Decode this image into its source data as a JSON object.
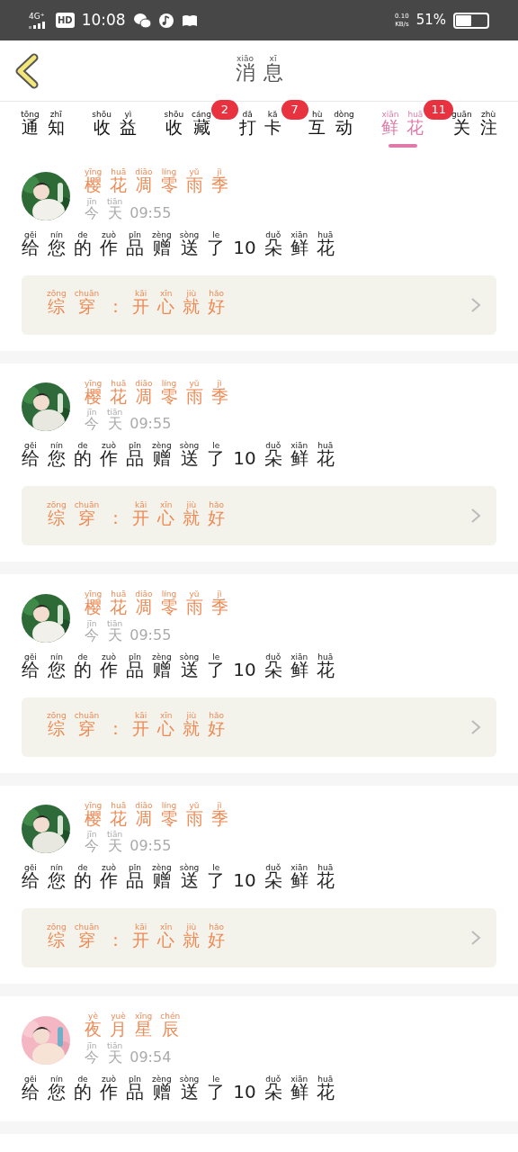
{
  "status_bar": {
    "network": "4G⁺",
    "hd": "HD",
    "time": "10:08",
    "speed": "0.10",
    "speed_unit": "KB/s",
    "battery": "51%"
  },
  "header": {
    "title": [
      [
        "xiāo",
        "消"
      ],
      [
        "xī",
        "息"
      ]
    ]
  },
  "tabs": [
    {
      "label": [
        [
          "tōng",
          "通"
        ],
        [
          "zhī",
          "知"
        ]
      ],
      "selected": false
    },
    {
      "label": [
        [
          "shōu",
          "收"
        ],
        [
          "yì",
          "益"
        ]
      ],
      "selected": false
    },
    {
      "label": [
        [
          "shōu",
          "收"
        ],
        [
          "cáng",
          "藏"
        ]
      ],
      "selected": false,
      "badge": "2"
    },
    {
      "label": [
        [
          "dǎ",
          "打"
        ],
        [
          "kǎ",
          "卡"
        ]
      ],
      "selected": false,
      "badge": "7"
    },
    {
      "label": [
        [
          "hù",
          "互"
        ],
        [
          "dòng",
          "动"
        ]
      ],
      "selected": false
    },
    {
      "label": [
        [
          "xiān",
          "鲜"
        ],
        [
          "huā",
          "花"
        ]
      ],
      "selected": true,
      "badge": "11"
    },
    {
      "label": [
        [
          "guān",
          "关"
        ],
        [
          "zhù",
          "注"
        ]
      ],
      "selected": false
    }
  ],
  "messages": [
    {
      "avatar": {
        "kind": "picture"
      },
      "name": [
        [
          "yīng",
          "樱"
        ],
        [
          "huā",
          "花"
        ],
        [
          "diāo",
          "凋"
        ],
        [
          "líng",
          "零"
        ],
        [
          "yǔ",
          "雨"
        ],
        [
          "jì",
          "季"
        ]
      ],
      "day": [
        [
          "jīn",
          "今"
        ],
        [
          "tiān",
          "天"
        ]
      ],
      "time": "09:55",
      "text": [
        [
          "gěi",
          "给"
        ],
        [
          "nín",
          "您"
        ],
        [
          "de",
          "的"
        ],
        [
          "zuò",
          "作"
        ],
        [
          "pǐn",
          "品"
        ],
        [
          "zèng",
          "赠"
        ],
        [
          "sòng",
          "送"
        ],
        [
          "le",
          "了"
        ],
        [
          "10"
        ],
        [
          "duǒ",
          "朵"
        ],
        [
          "xiān",
          "鲜"
        ],
        [
          "huā",
          "花"
        ]
      ],
      "work": [
        [
          "zōng",
          "综"
        ],
        [
          "chuān",
          "穿"
        ],
        [
          "："
        ],
        [
          "kāi",
          "开"
        ],
        [
          "xīn",
          "心"
        ],
        [
          "jiù",
          "就"
        ],
        [
          "hǎo",
          "好"
        ]
      ]
    },
    {
      "avatar": {
        "kind": "picture"
      },
      "name": [
        [
          "yīng",
          "樱"
        ],
        [
          "huā",
          "花"
        ],
        [
          "diāo",
          "凋"
        ],
        [
          "líng",
          "零"
        ],
        [
          "yǔ",
          "雨"
        ],
        [
          "jì",
          "季"
        ]
      ],
      "day": [
        [
          "jīn",
          "今"
        ],
        [
          "tiān",
          "天"
        ]
      ],
      "time": "09:55",
      "text": [
        [
          "gěi",
          "给"
        ],
        [
          "nín",
          "您"
        ],
        [
          "de",
          "的"
        ],
        [
          "zuò",
          "作"
        ],
        [
          "pǐn",
          "品"
        ],
        [
          "zèng",
          "赠"
        ],
        [
          "sòng",
          "送"
        ],
        [
          "le",
          "了"
        ],
        [
          "10"
        ],
        [
          "duǒ",
          "朵"
        ],
        [
          "xiān",
          "鲜"
        ],
        [
          "huā",
          "花"
        ]
      ],
      "work": [
        [
          "zōng",
          "综"
        ],
        [
          "chuān",
          "穿"
        ],
        [
          "："
        ],
        [
          "kāi",
          "开"
        ],
        [
          "xīn",
          "心"
        ],
        [
          "jiù",
          "就"
        ],
        [
          "hǎo",
          "好"
        ]
      ]
    },
    {
      "avatar": {
        "kind": "picture"
      },
      "name": [
        [
          "yīng",
          "樱"
        ],
        [
          "huā",
          "花"
        ],
        [
          "diāo",
          "凋"
        ],
        [
          "líng",
          "零"
        ],
        [
          "yǔ",
          "雨"
        ],
        [
          "jì",
          "季"
        ]
      ],
      "day": [
        [
          "jīn",
          "今"
        ],
        [
          "tiān",
          "天"
        ]
      ],
      "time": "09:55",
      "text": [
        [
          "gěi",
          "给"
        ],
        [
          "nín",
          "您"
        ],
        [
          "de",
          "的"
        ],
        [
          "zuò",
          "作"
        ],
        [
          "pǐn",
          "品"
        ],
        [
          "zèng",
          "赠"
        ],
        [
          "sòng",
          "送"
        ],
        [
          "le",
          "了"
        ],
        [
          "10"
        ],
        [
          "duǒ",
          "朵"
        ],
        [
          "xiān",
          "鲜"
        ],
        [
          "huā",
          "花"
        ]
      ],
      "work": [
        [
          "zōng",
          "综"
        ],
        [
          "chuān",
          "穿"
        ],
        [
          "："
        ],
        [
          "kāi",
          "开"
        ],
        [
          "xīn",
          "心"
        ],
        [
          "jiù",
          "就"
        ],
        [
          "hǎo",
          "好"
        ]
      ]
    },
    {
      "avatar": {
        "kind": "picture"
      },
      "name": [
        [
          "yīng",
          "樱"
        ],
        [
          "huā",
          "花"
        ],
        [
          "diāo",
          "凋"
        ],
        [
          "líng",
          "零"
        ],
        [
          "yǔ",
          "雨"
        ],
        [
          "jì",
          "季"
        ]
      ],
      "day": [
        [
          "jīn",
          "今"
        ],
        [
          "tiān",
          "天"
        ]
      ],
      "time": "09:55",
      "text": [
        [
          "gěi",
          "给"
        ],
        [
          "nín",
          "您"
        ],
        [
          "de",
          "的"
        ],
        [
          "zuò",
          "作"
        ],
        [
          "pǐn",
          "品"
        ],
        [
          "zèng",
          "赠"
        ],
        [
          "sòng",
          "送"
        ],
        [
          "le",
          "了"
        ],
        [
          "10"
        ],
        [
          "duǒ",
          "朵"
        ],
        [
          "xiān",
          "鲜"
        ],
        [
          "huā",
          "花"
        ]
      ],
      "work": [
        [
          "zōng",
          "综"
        ],
        [
          "chuān",
          "穿"
        ],
        [
          "："
        ],
        [
          "kāi",
          "开"
        ],
        [
          "xīn",
          "心"
        ],
        [
          "jiù",
          "就"
        ],
        [
          "hǎo",
          "好"
        ]
      ]
    },
    {
      "avatar": {
        "kind": "picture"
      },
      "name": [
        [
          "yè",
          "夜"
        ],
        [
          "yuè",
          "月"
        ],
        [
          "xīng",
          "星"
        ],
        [
          "chén",
          "辰"
        ]
      ],
      "day": [
        [
          "jīn",
          "今"
        ],
        [
          "tiān",
          "天"
        ]
      ],
      "time": "09:54",
      "text": [
        [
          "gěi",
          "给"
        ],
        [
          "nín",
          "您"
        ],
        [
          "de",
          "的"
        ],
        [
          "zuò",
          "作"
        ],
        [
          "pǐn",
          "品"
        ],
        [
          "zèng",
          "赠"
        ],
        [
          "sòng",
          "送"
        ],
        [
          "le",
          "了"
        ],
        [
          "10"
        ],
        [
          "duǒ",
          "朵"
        ],
        [
          "xiān",
          "鲜"
        ],
        [
          "huā",
          "花"
        ]
      ]
    }
  ]
}
